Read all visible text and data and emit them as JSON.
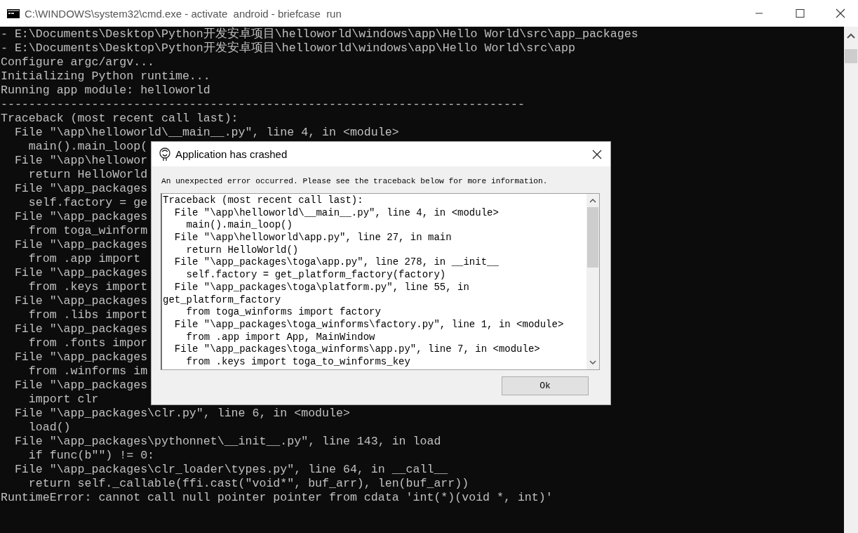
{
  "window": {
    "title": "C:\\WINDOWS\\system32\\cmd.exe - activate  android - briefcase  run"
  },
  "console_lines": [
    "- E:\\Documents\\Desktop\\Python开发安卓项目\\helloworld\\windows\\app\\Hello World\\src\\app_packages",
    "- E:\\Documents\\Desktop\\Python开发安卓项目\\helloworld\\windows\\app\\Hello World\\src\\app",
    "Configure argc/argv...",
    "Initializing Python runtime...",
    "Running app module: helloworld",
    "---------------------------------------------------------------------------",
    "Traceback (most recent call last):",
    "  File \"\\app\\helloworld\\__main__.py\", line 4, in <module>",
    "    main().main_loop(",
    "  File \"\\app\\hellowor",
    "    return HelloWorld",
    "  File \"\\app_packages",
    "    self.factory = ge",
    "  File \"\\app_packages",
    "    from toga_winform",
    "  File \"\\app_packages",
    "    from .app import",
    "  File \"\\app_packages",
    "    from .keys import",
    "  File \"\\app_packages",
    "    from .libs import",
    "  File \"\\app_packages",
    "    from .fonts impor",
    "  File \"\\app_packages",
    "    from .winforms im",
    "  File \"\\app_packages",
    "    import clr",
    "  File \"\\app_packages\\clr.py\", line 6, in <module>",
    "    load()",
    "  File \"\\app_packages\\pythonnet\\__init__.py\", line 143, in load",
    "    if func(b\"\") != 0:",
    "  File \"\\app_packages\\clr_loader\\types.py\", line 64, in __call__",
    "    return self._callable(ffi.cast(\"void*\", buf_arr), len(buf_arr))",
    "RuntimeError: cannot call null pointer pointer from cdata 'int(*)(void *, int)'"
  ],
  "dialog": {
    "title": "Application has crashed",
    "message": "An unexpected error occurred. Please see the traceback below for more information.",
    "traceback_lines": [
      "Traceback (most recent call last):",
      "  File \"\\app\\helloworld\\__main__.py\", line 4, in <module>",
      "    main().main_loop()",
      "  File \"\\app\\helloworld\\app.py\", line 27, in main",
      "    return HelloWorld()",
      "  File \"\\app_packages\\toga\\app.py\", line 278, in __init__",
      "    self.factory = get_platform_factory(factory)",
      "  File \"\\app_packages\\toga\\platform.py\", line 55, in",
      "get_platform_factory",
      "    from toga_winforms import factory",
      "  File \"\\app_packages\\toga_winforms\\factory.py\", line 1, in <module>",
      "    from .app import App, MainWindow",
      "  File \"\\app_packages\\toga_winforms\\app.py\", line 7, in <module>",
      "    from .keys import toga_to_winforms_key"
    ],
    "buttons": [
      "Ok"
    ]
  }
}
